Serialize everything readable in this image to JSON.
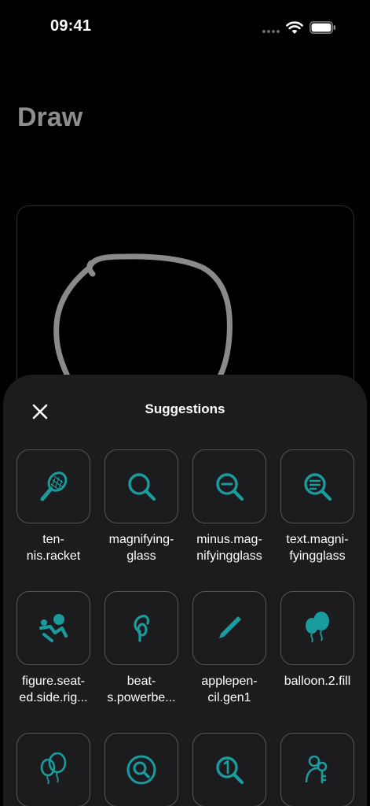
{
  "status_bar": {
    "time": "09:41"
  },
  "page": {
    "title": "Draw"
  },
  "sheet": {
    "title": "Suggestions",
    "accent_color": "#1a9b9e",
    "items": [
      {
        "label": "ten-\nnis.racket",
        "icon": "tennis-racket-icon"
      },
      {
        "label": "magnifying-\nglass",
        "icon": "magnifyingglass-icon"
      },
      {
        "label": "minus.mag-\nnifyingglass",
        "icon": "minus-magnifyingglass-icon"
      },
      {
        "label": "text.magni-\nfyingglass",
        "icon": "text-magnifyingglass-icon"
      },
      {
        "label": "figure.seat-\ned.side.rig...",
        "icon": "figure-seated-side-icon"
      },
      {
        "label": "beat-\ns.powerbe...",
        "icon": "beats-powerbeats-icon"
      },
      {
        "label": "applepen-\ncil.gen1",
        "icon": "applepencil-icon"
      },
      {
        "label": "balloon.2.fill",
        "icon": "balloon-2-fill-icon"
      },
      {
        "label": "",
        "icon": "balloon-2-icon"
      },
      {
        "label": "",
        "icon": "magnifyingglass-circle-icon"
      },
      {
        "label": "",
        "icon": "1-magnifyingglass-icon"
      },
      {
        "label": "",
        "icon": "person-2-key-icon"
      }
    ]
  }
}
